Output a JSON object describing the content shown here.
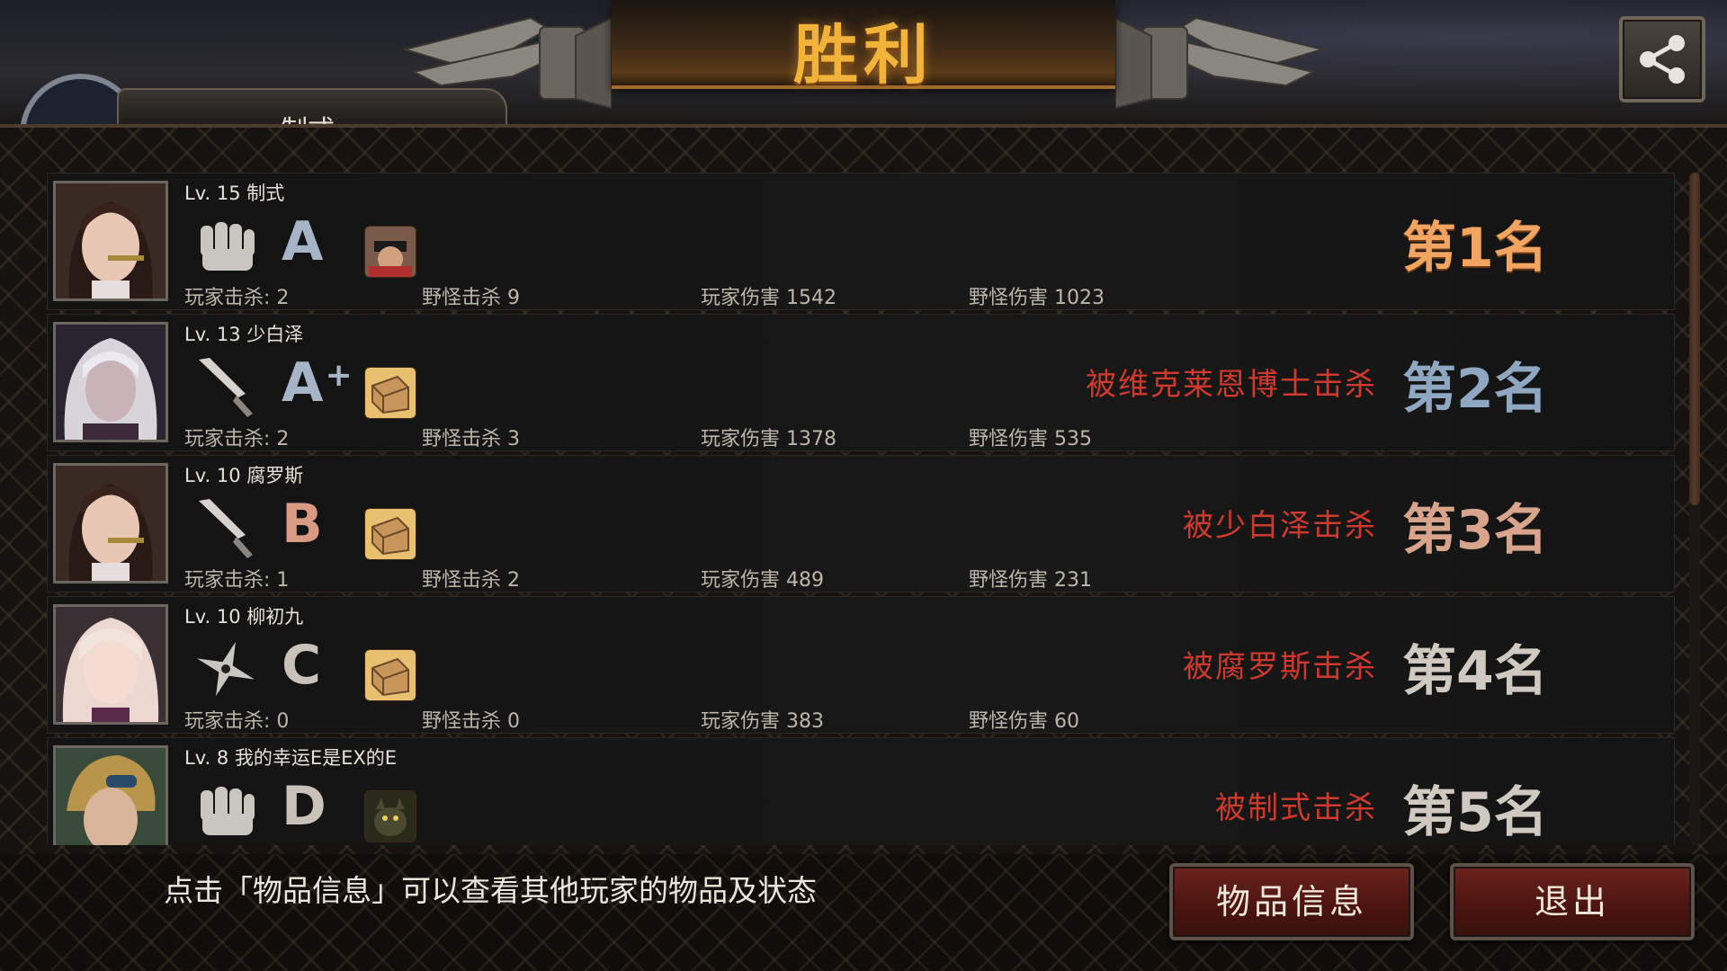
{
  "header": {
    "title": "胜利",
    "player_name": "制式",
    "colors": {
      "title": "#f2b33a",
      "kill_text": "#d0392e"
    }
  },
  "players": [
    {
      "level": "Lv. 15 制式",
      "weapon_icon": "fist-icon",
      "grade": "A",
      "grade_plus": "",
      "grade_color": "#a7b4c8",
      "item_icon": "binoculars-soldier-icon",
      "killed_by": "",
      "rank": "第1名",
      "rank_color": "#f1a560",
      "stats": {
        "player_kills": "玩家击杀: 2",
        "monster_kills": "野怪击杀 9",
        "player_damage": "玩家伤害 1542",
        "monster_damage": "野怪伤害 1023"
      }
    },
    {
      "level": "Lv. 13 少白泽",
      "weapon_icon": "knife-icon",
      "grade": "A",
      "grade_plus": "+",
      "grade_color": "#a7b4c8",
      "item_icon": "bread-icon",
      "killed_by": "被维克莱恩博士击杀",
      "rank": "第2名",
      "rank_color": "#8fa7c0",
      "stats": {
        "player_kills": "玩家击杀: 2",
        "monster_kills": "野怪击杀 3",
        "player_damage": "玩家伤害 1378",
        "monster_damage": "野怪伤害 535"
      }
    },
    {
      "level": "Lv. 10 腐罗斯",
      "weapon_icon": "knife-icon",
      "grade": "B",
      "grade_plus": "",
      "grade_color": "#d89a83",
      "item_icon": "bread-icon",
      "killed_by": "被少白泽击杀",
      "rank": "第3名",
      "rank_color": "#d8a48c",
      "stats": {
        "player_kills": "玩家击杀: 1",
        "monster_kills": "野怪击杀 2",
        "player_damage": "玩家伤害 489",
        "monster_damage": "野怪伤害 231"
      }
    },
    {
      "level": "Lv. 10 柳初九",
      "weapon_icon": "shuriken-icon",
      "grade": "C",
      "grade_plus": "",
      "grade_color": "#c8c2ba",
      "item_icon": "bread-icon",
      "killed_by": "被腐罗斯击杀",
      "rank": "第4名",
      "rank_color": "#cfc9c1",
      "stats": {
        "player_kills": "玩家击杀: 0",
        "monster_kills": "野怪击杀 0",
        "player_damage": "玩家伤害 383",
        "monster_damage": "野怪伤害 60"
      }
    },
    {
      "level": "Lv. 8   我的幸运E是EX的E",
      "weapon_icon": "fist-icon",
      "grade": "D",
      "grade_plus": "",
      "grade_color": "#c8c2ba",
      "item_icon": "creature-icon",
      "killed_by": "被制式击杀",
      "rank": "第5名",
      "rank_color": "#cfc9c1",
      "stats": {
        "player_kills": "",
        "monster_kills": "",
        "player_damage": "",
        "monster_damage": ""
      }
    }
  ],
  "footer": {
    "hint": "点击「物品信息」可以查看其他玩家的物品及状态",
    "item_info_label": "物品信息",
    "exit_label": "退出"
  }
}
